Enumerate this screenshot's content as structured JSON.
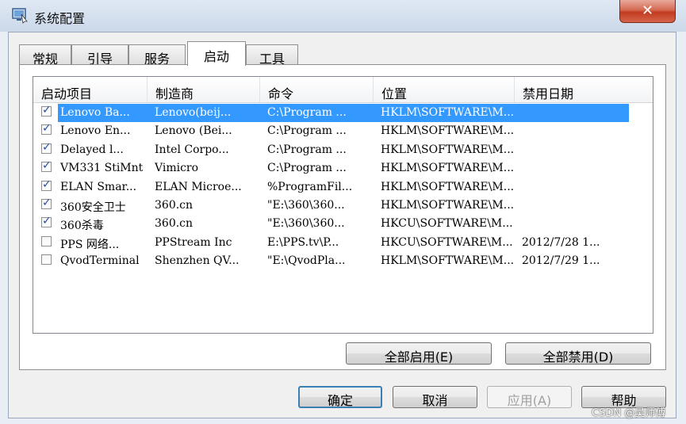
{
  "window": {
    "title": "系统配置",
    "close_glyph": "✕",
    "icon": "monitor-icon"
  },
  "tabs": [
    {
      "label": "常规",
      "active": false
    },
    {
      "label": "引导",
      "active": false
    },
    {
      "label": "服务",
      "active": false
    },
    {
      "label": "启动",
      "active": true
    },
    {
      "label": "工具",
      "active": false
    }
  ],
  "columns": [
    "启动项目",
    "制造商",
    "命令",
    "位置",
    "禁用日期"
  ],
  "rows": [
    {
      "checked": true,
      "selected": true,
      "item": "Lenovo Ba...",
      "maker": "Lenovo(beij...",
      "command": "C:\\Program ...",
      "location": "HKLM\\SOFTWARE\\M...",
      "date": ""
    },
    {
      "checked": true,
      "selected": false,
      "item": "Lenovo En...",
      "maker": "Lenovo (Bei...",
      "command": "C:\\Program ...",
      "location": "HKLM\\SOFTWARE\\M...",
      "date": ""
    },
    {
      "checked": true,
      "selected": false,
      "item": "Delayed l...",
      "maker": "Intel Corpo...",
      "command": "C:\\Program ...",
      "location": "HKLM\\SOFTWARE\\M...",
      "date": ""
    },
    {
      "checked": true,
      "selected": false,
      "item": "VM331 StiMnt",
      "maker": "Vimicro",
      "command": "C:\\Program ...",
      "location": "HKLM\\SOFTWARE\\M...",
      "date": ""
    },
    {
      "checked": true,
      "selected": false,
      "item": "ELAN Smar...",
      "maker": "ELAN Microe...",
      "command": "%ProgramFil...",
      "location": "HKLM\\SOFTWARE\\M...",
      "date": ""
    },
    {
      "checked": true,
      "selected": false,
      "item": "360安全卫士",
      "maker": "360.cn",
      "command": "\"E:\\360\\360...",
      "location": "HKLM\\SOFTWARE\\M...",
      "date": ""
    },
    {
      "checked": true,
      "selected": false,
      "item": "360杀毒",
      "maker": "360.cn",
      "command": "\"E:\\360\\360...",
      "location": "HKCU\\SOFTWARE\\M...",
      "date": ""
    },
    {
      "checked": false,
      "selected": false,
      "item": "PPS 网络...",
      "maker": "PPStream Inc",
      "command": "E:\\PPS.tv\\P...",
      "location": "HKCU\\SOFTWARE\\M...",
      "date": "2012/7/28 1..."
    },
    {
      "checked": false,
      "selected": false,
      "item": "QvodTerminal",
      "maker": "Shenzhen QV...",
      "command": "\"E:\\QvodPla...",
      "location": "HKLM\\SOFTWARE\\M...",
      "date": "2012/7/29 1..."
    }
  ],
  "actions": {
    "enable_all": "全部启用(E)",
    "disable_all": "全部禁用(D)"
  },
  "dialog_buttons": {
    "ok": "确定",
    "cancel": "取消",
    "apply": "应用(A)",
    "help": "帮助"
  },
  "checkmark": "✓",
  "watermark": "CSDN @吴师傅",
  "colors": {
    "selection": "#3399ff",
    "title_bar": "#dfe8f3",
    "close_button": "#c23b20"
  }
}
